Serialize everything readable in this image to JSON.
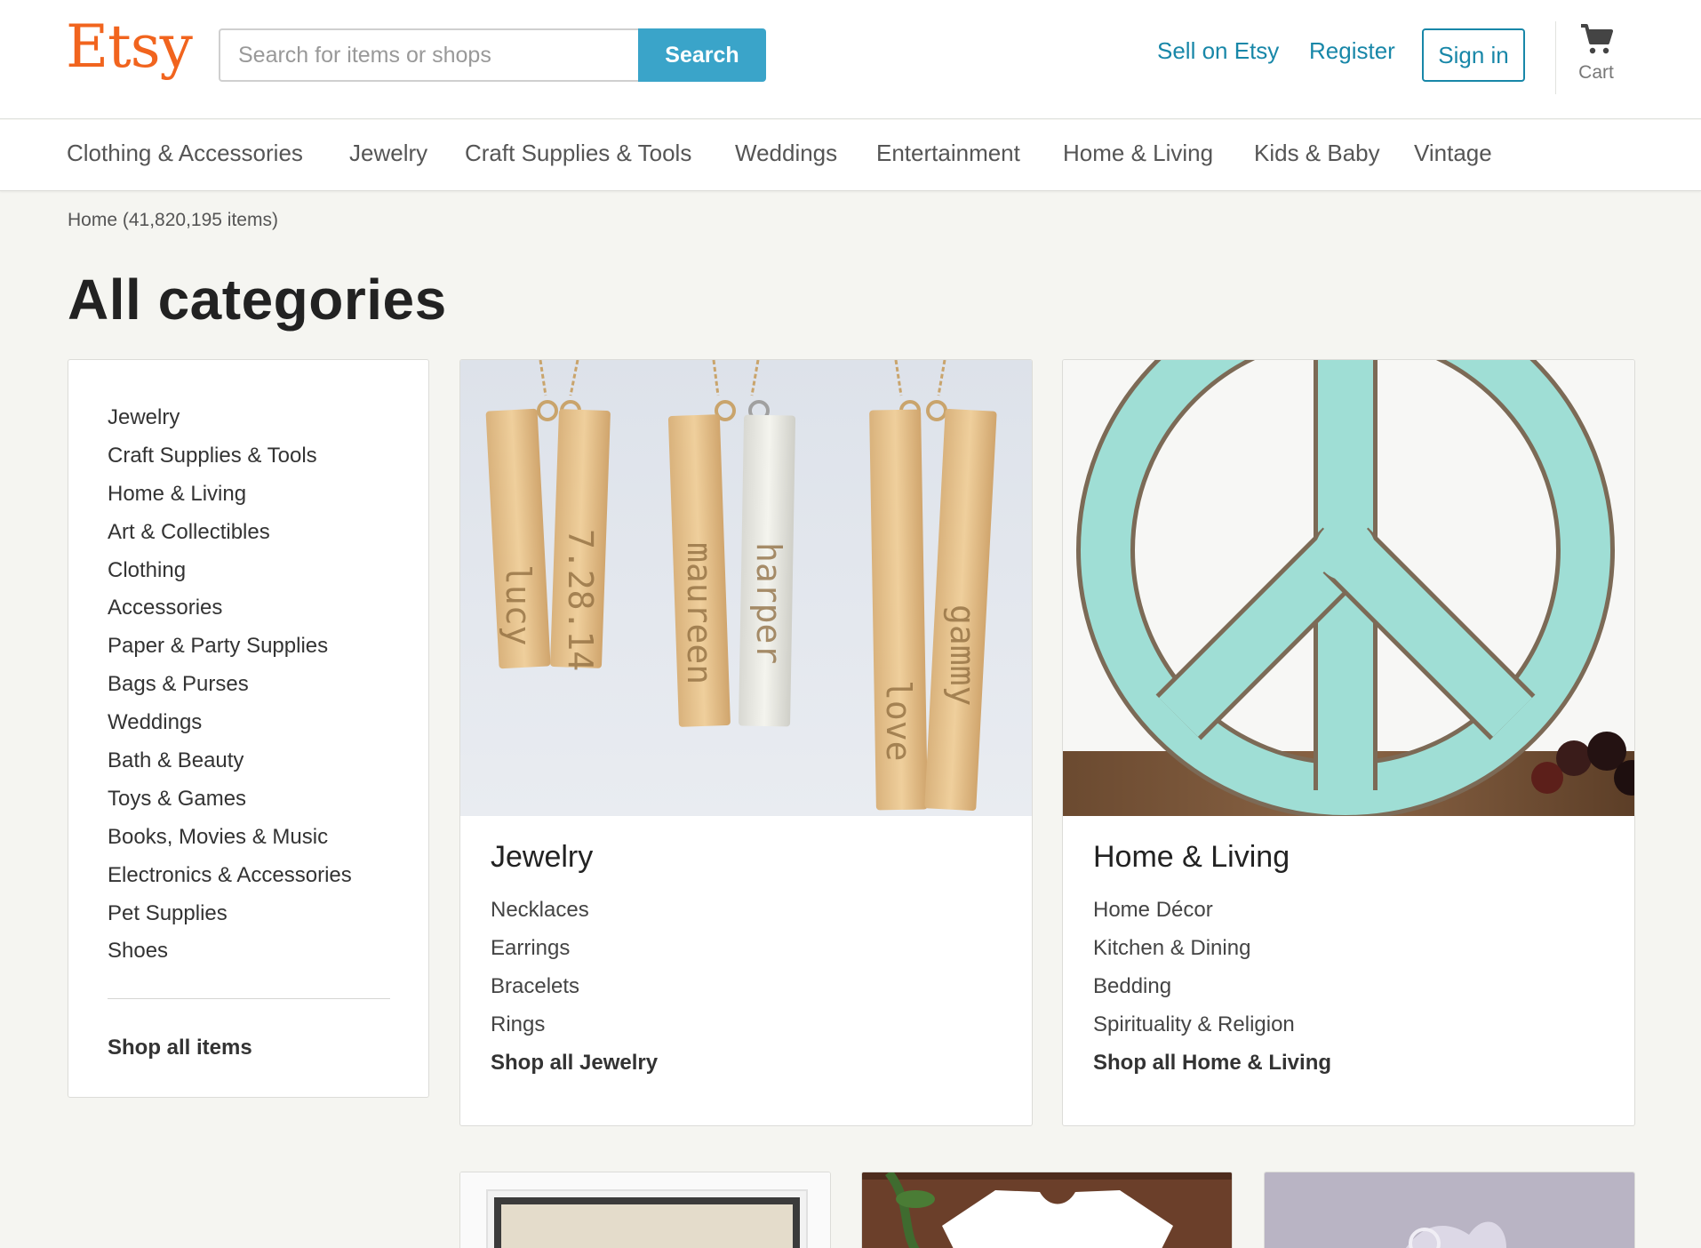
{
  "header": {
    "logo": "Etsy",
    "search_placeholder": "Search for items or shops",
    "search_label": "Search",
    "sell_label": "Sell on Etsy",
    "register_label": "Register",
    "signin_label": "Sign in",
    "cart_label": "Cart",
    "brand_color": "#f1641e",
    "accent_color": "#1887a8"
  },
  "nav": {
    "items": [
      "Clothing & Accessories",
      "Jewelry",
      "Craft Supplies & Tools",
      "Weddings",
      "Entertainment",
      "Home & Living",
      "Kids & Baby",
      "Vintage"
    ]
  },
  "breadcrumb": "Home (41,820,195 items)",
  "page_title": "All categories",
  "sidebar": {
    "items": [
      "Jewelry",
      "Craft Supplies & Tools",
      "Home & Living",
      "Art & Collectibles",
      "Clothing",
      "Accessories",
      "Paper & Party Supplies",
      "Bags & Purses",
      "Weddings",
      "Bath & Beauty",
      "Toys & Games",
      "Books, Movies & Music",
      "Electronics & Accessories",
      "Pet Supplies",
      "Shoes"
    ],
    "shop_all": "Shop all items"
  },
  "cards": [
    {
      "title": "Jewelry",
      "subcategories": [
        "Necklaces",
        "Earrings",
        "Bracelets",
        "Rings"
      ],
      "shop_all": "Shop all Jewelry",
      "image_text": [
        "lucy",
        "7.28.14",
        "maureen",
        "harper",
        "love",
        "gammy"
      ]
    },
    {
      "title": "Home & Living",
      "subcategories": [
        "Home Décor",
        "Kitchen & Dining",
        "Bedding",
        "Spirituality & Religion"
      ],
      "shop_all": "Shop all Home & Living"
    }
  ]
}
